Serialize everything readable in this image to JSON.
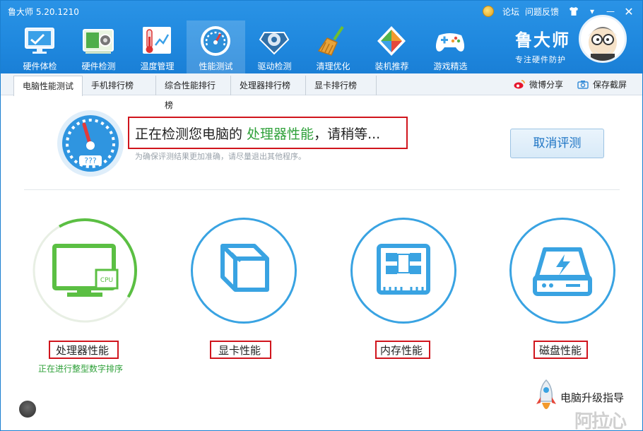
{
  "titlebar": {
    "app_title": "鲁大师 5.20.1210",
    "links": [
      "论坛",
      "问题反馈"
    ],
    "skin_icon": "shirt-icon",
    "min_glyph": "—",
    "close_glyph": "✕",
    "menu_glyph": "▾"
  },
  "toolbar": {
    "items": [
      {
        "label": "硬件体检",
        "icon": "monitor-check-icon"
      },
      {
        "label": "硬件检测",
        "icon": "circuit-board-icon"
      },
      {
        "label": "温度管理",
        "icon": "thermometer-icon"
      },
      {
        "label": "性能测试",
        "icon": "speedometer-icon"
      },
      {
        "label": "驱动检测",
        "icon": "gear-chip-icon"
      },
      {
        "label": "清理优化",
        "icon": "broom-icon"
      },
      {
        "label": "装机推荐",
        "icon": "cube-icon"
      },
      {
        "label": "游戏精选",
        "icon": "gamepad-icon"
      }
    ],
    "active_index": 3
  },
  "brand": {
    "name": "鲁大师",
    "slogan": "专注硬件防护"
  },
  "tabs": {
    "items": [
      "电脑性能测试",
      "手机排行榜",
      "综合性能排行榜",
      "处理器排行榜",
      "显卡排行榜"
    ],
    "active_index": 0,
    "right": [
      "微博分享",
      "保存截屏"
    ]
  },
  "header": {
    "gauge_text": "???",
    "headline_prefix": "正在检测您电脑的 ",
    "headline_highlight": "处理器性能",
    "headline_suffix": "，请稍等...",
    "subline": "为确保评测结果更加准确，请尽量退出其他程序。",
    "cancel_label": "取消评测"
  },
  "perf": [
    {
      "label": "处理器性能",
      "icon": "monitor-cpu-icon",
      "status": "正在进行整型数字排序",
      "progress": 0.42
    },
    {
      "label": "显卡性能",
      "icon": "cube-outline-icon"
    },
    {
      "label": "内存性能",
      "icon": "memory-chip-icon"
    },
    {
      "label": "磁盘性能",
      "icon": "hard-drive-icon"
    }
  ],
  "chip_text": "CPU",
  "bottom": {
    "upgrade_label": "电脑升级指导",
    "watermark": "阿拉心"
  },
  "colors": {
    "accent_blue": "#1f88de",
    "progress_green": "#5bbf43",
    "highlight_green": "#2fa13a",
    "annotation_red": "#d0151d"
  }
}
